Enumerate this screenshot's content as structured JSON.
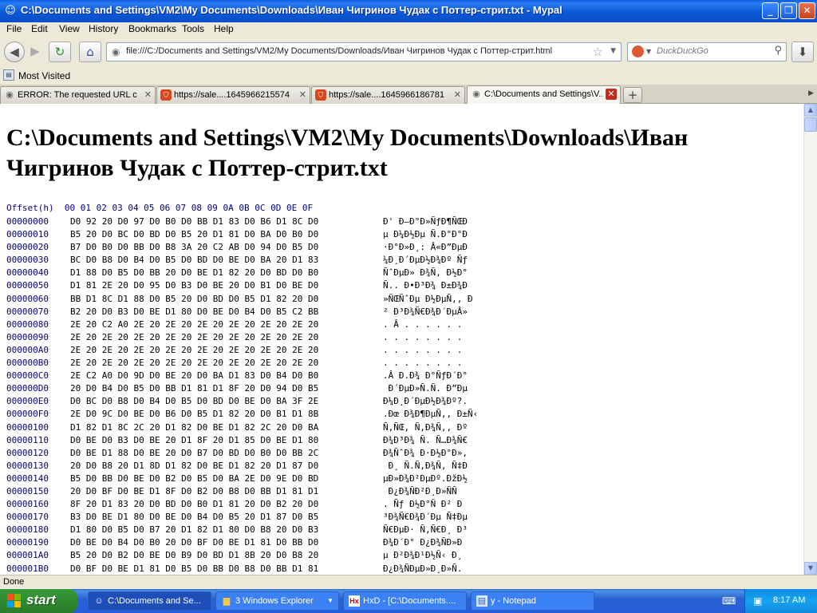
{
  "window": {
    "title": "C:\\Documents and Settings\\VM2\\My Documents\\Downloads\\Иван Чигринов Чудак с Поттер-стрит.txt - Mypal",
    "app_icon": "mypal-icon",
    "minimize_glyph": "_",
    "maximize_glyph": "❐",
    "close_glyph": "✕"
  },
  "menu": [
    "File",
    "Edit",
    "View",
    "History",
    "Bookmarks",
    "Tools",
    "Help"
  ],
  "nav": {
    "back_glyph": "◀",
    "forward_glyph": "▶",
    "reload_glyph": "↻",
    "home_glyph": "⌂",
    "url": "file:///C:/Documents and Settings/VM2/My Documents/Downloads/Иван Чигринов Чудак с Поттер-стрит.html",
    "star_glyph": "☆",
    "search_placeholder": "DuckDuckGo",
    "download_glyph": "⬇"
  },
  "bookmarks": {
    "label": "Most Visited"
  },
  "tabs": [
    {
      "label": "ERROR: The requested URL c...",
      "icon": "grey",
      "active": false
    },
    {
      "label": "https://sale....1645966215574",
      "icon": "red",
      "active": false
    },
    {
      "label": "https://sale....1645966186781",
      "icon": "red",
      "active": false
    },
    {
      "label": "C:\\Documents and Settings\\V...",
      "icon": "grey",
      "active": true
    }
  ],
  "page": {
    "heading": "C:\\Documents and Settings\\VM2\\My Documents\\Downloads\\Иван Чигринов Чудак с Поттер-стрит.txt",
    "hex_header": "Offset(h)  00 01 02 03 04 05 06 07 08 09 0A 0B 0C 0D 0E 0F",
    "rows": [
      {
        "off": "00000000",
        "bytes": "D0 92 20 D0 97 D0 B0 D0 BB D1 83 D0 B6 D1 8C D0",
        "ascii": "Ð' Ð—Ð°Ð»ÑƒÐ¶ÑŒÐ"
      },
      {
        "off": "00000010",
        "bytes": "B5 20 D0 BC D0 BD D0 B5 20 D1 81 D0 BA D0 B0 D0",
        "ascii": "µ Ð¼Ð½Ðµ Ñ.Ð°Ð°Ð"
      },
      {
        "off": "00000020",
        "bytes": "B7 D0 B0 D0 BB D0 B8 3A 20 C2 AB D0 94 D0 B5 D0",
        "ascii": "·Ð°Ð»Ð¸: Â«Ð”ÐµÐ"
      },
      {
        "off": "00000030",
        "bytes": "BC D0 B8 D0 B4 D0 B5 D0 BD D0 BE D0 BA 20 D1 83",
        "ascii": "¼Ð¸Ð´ÐµÐ½Ð¾Ðº Ñƒ"
      },
      {
        "off": "00000040",
        "bytes": "D1 88 D0 B5 D0 BB 20 D0 BE D1 82 20 D0 BD D0 B0",
        "ascii": "ÑˆÐµÐ» Ð¾Ñ‚ Ð½Ð°"
      },
      {
        "off": "00000050",
        "bytes": "D1 81 2E 20 D0 95 D0 B3 D0 BE 20 D0 B1 D0 BE D0",
        "ascii": "Ñ.. Ð•Ð³Ð¾ Ð±Ð¾Ð"
      },
      {
        "off": "00000060",
        "bytes": "BB D1 8C D1 88 D0 B5 20 D0 BD D0 B5 D1 82 20 D0",
        "ascii": "»ÑŒÑˆÐµ Ð½ÐµÑ‚, Ð"
      },
      {
        "off": "00000070",
        "bytes": "B2 20 D0 B3 D0 BE D1 80 D0 BE D0 B4 D0 B5 C2 BB",
        "ascii": "² Ð³Ð¾Ñ€Ð¾Ð´ÐµÂ»"
      },
      {
        "off": "00000080",
        "bytes": "2E 20 C2 A0 2E 20 2E 20 2E 20 2E 20 2E 20 2E 20",
        "ascii": ". Â . . . . . ."
      },
      {
        "off": "00000090",
        "bytes": "2E 20 2E 20 2E 20 2E 20 2E 20 2E 20 2E 20 2E 20",
        "ascii": ". . . . . . . ."
      },
      {
        "off": "000000A0",
        "bytes": "2E 20 2E 20 2E 20 2E 20 2E 20 2E 20 2E 20 2E 20",
        "ascii": ". . . . . . . ."
      },
      {
        "off": "000000B0",
        "bytes": "2E 20 2E 20 2E 20 2E 20 2E 20 2E 20 2E 20 2E 20",
        "ascii": ". . . . . . . ."
      },
      {
        "off": "000000C0",
        "bytes": "2E C2 A0 D0 9D D0 BE 20 D0 BA D1 83 D0 B4 D0 B0",
        "ascii": ".Â Ð.Ð¾ Ð°ÑƒÐ´Ð°"
      },
      {
        "off": "000000D0",
        "bytes": "20 D0 B4 D0 B5 D0 BB D1 81 D1 8F 20 D0 94 D0 B5",
        "ascii": " Ð´ÐµÐ»Ñ.Ñ. Ð”Ðµ"
      },
      {
        "off": "000000E0",
        "bytes": "D0 BC D0 B8 D0 B4 D0 B5 D0 BD D0 BE D0 BA 3F 2E",
        "ascii": "Ð¼Ð¸Ð´ÐµÐ½Ð¾Ðº?."
      },
      {
        "off": "000000F0",
        "bytes": "2E D0 9C D0 BE D0 B6 D0 B5 D1 82 20 D0 B1 D1 8B",
        "ascii": ".Ðœ Ð¾Ð¶ÐµÑ‚, Ð±Ñ‹"
      },
      {
        "off": "00000100",
        "bytes": "D1 82 D1 8C 2C 20 D1 82 D0 BE D1 82 2C 20 D0 BA",
        "ascii": "Ñ‚ÑŒ, Ñ‚Ð¾Ñ‚, Ðº"
      },
      {
        "off": "00000110",
        "bytes": "D0 BE D0 B3 D0 BE 20 D1 8F 20 D1 85 D0 BE D1 80",
        "ascii": "Ð¾Ð³Ð¾ Ñ. Ñ…Ð¾Ñ€"
      },
      {
        "off": "00000120",
        "bytes": "D0 BE D1 88 D0 BE 20 D0 B7 D0 BD D0 B0 D0 BB 2C",
        "ascii": "Ð¾ÑˆÐ¾ Ð·Ð½Ð°Ð»,"
      },
      {
        "off": "00000130",
        "bytes": "20 D0 B8 20 D1 8D D1 82 D0 BE D1 82 20 D1 87 D0",
        "ascii": " Ð¸ Ñ.Ñ‚Ð¾Ñ‚ Ñ‡Ð"
      },
      {
        "off": "00000140",
        "bytes": "B5 D0 BB D0 BE D0 B2 D0 B5 D0 BA 2E D0 9E D0 BD",
        "ascii": "µÐ»Ð¾Ð²ÐµÐº.ÐžÐ½"
      },
      {
        "off": "00000150",
        "bytes": "20 D0 BF D0 BE D1 8F D0 B2 D0 B8 D0 BB D1 81 D1",
        "ascii": " Ð¿Ð¾ÑÐ²Ð¸Ð»ÑÑ"
      },
      {
        "off": "00000160",
        "bytes": "8F 20 D1 83 20 D0 BD D0 B0 D1 81 20 D0 B2 20 D0",
        "ascii": ". Ñƒ Ð½Ð°Ñ Ð² Ð"
      },
      {
        "off": "00000170",
        "bytes": "B3 D0 BE D1 80 D0 BE D0 B4 D0 B5 20 D1 87 D0 B5",
        "ascii": "³Ð¾Ñ€Ð¾Ð´Ðµ Ñ‡Ðµ"
      },
      {
        "off": "00000180",
        "bytes": "D1 80 D0 B5 D0 B7 20 D1 82 D1 80 D0 B8 20 D0 B3",
        "ascii": "Ñ€ÐµÐ· Ñ‚Ñ€Ð¸ Ð³"
      },
      {
        "off": "00000190",
        "bytes": "D0 BE D0 B4 D0 B0 20 D0 BF D0 BE D1 81 D0 BB D0",
        "ascii": "Ð¾Ð´Ð° Ð¿Ð¾ÑÐ»Ð"
      },
      {
        "off": "000001A0",
        "bytes": "B5 20 D0 B2 D0 BE D0 B9 D0 BD D1 8B 20 D0 B8 20",
        "ascii": "µ Ð²Ð¾Ð¹Ð½Ñ‹ Ð¸ "
      },
      {
        "off": "000001B0",
        "bytes": "D0 BF D0 BE D1 81 D0 B5 D0 BB D0 B8 D0 BB D1 81",
        "ascii": "Ð¿Ð¾ÑÐµÐ»Ð¸Ð»Ñ."
      }
    ]
  },
  "status": "Done",
  "taskbar": {
    "start_label": "start",
    "tasks": [
      {
        "label": "C:\\Documents and Se...",
        "icon": "mypal",
        "active": true
      },
      {
        "label": "3 Windows Explorer",
        "icon": "folder",
        "active": false,
        "has_menu": true
      },
      {
        "label": "HxD - [C:\\Documents....",
        "icon": "hxd",
        "active": false
      },
      {
        "label": "y - Notepad",
        "icon": "notepad",
        "active": false
      }
    ],
    "clock": "8:17 AM"
  }
}
